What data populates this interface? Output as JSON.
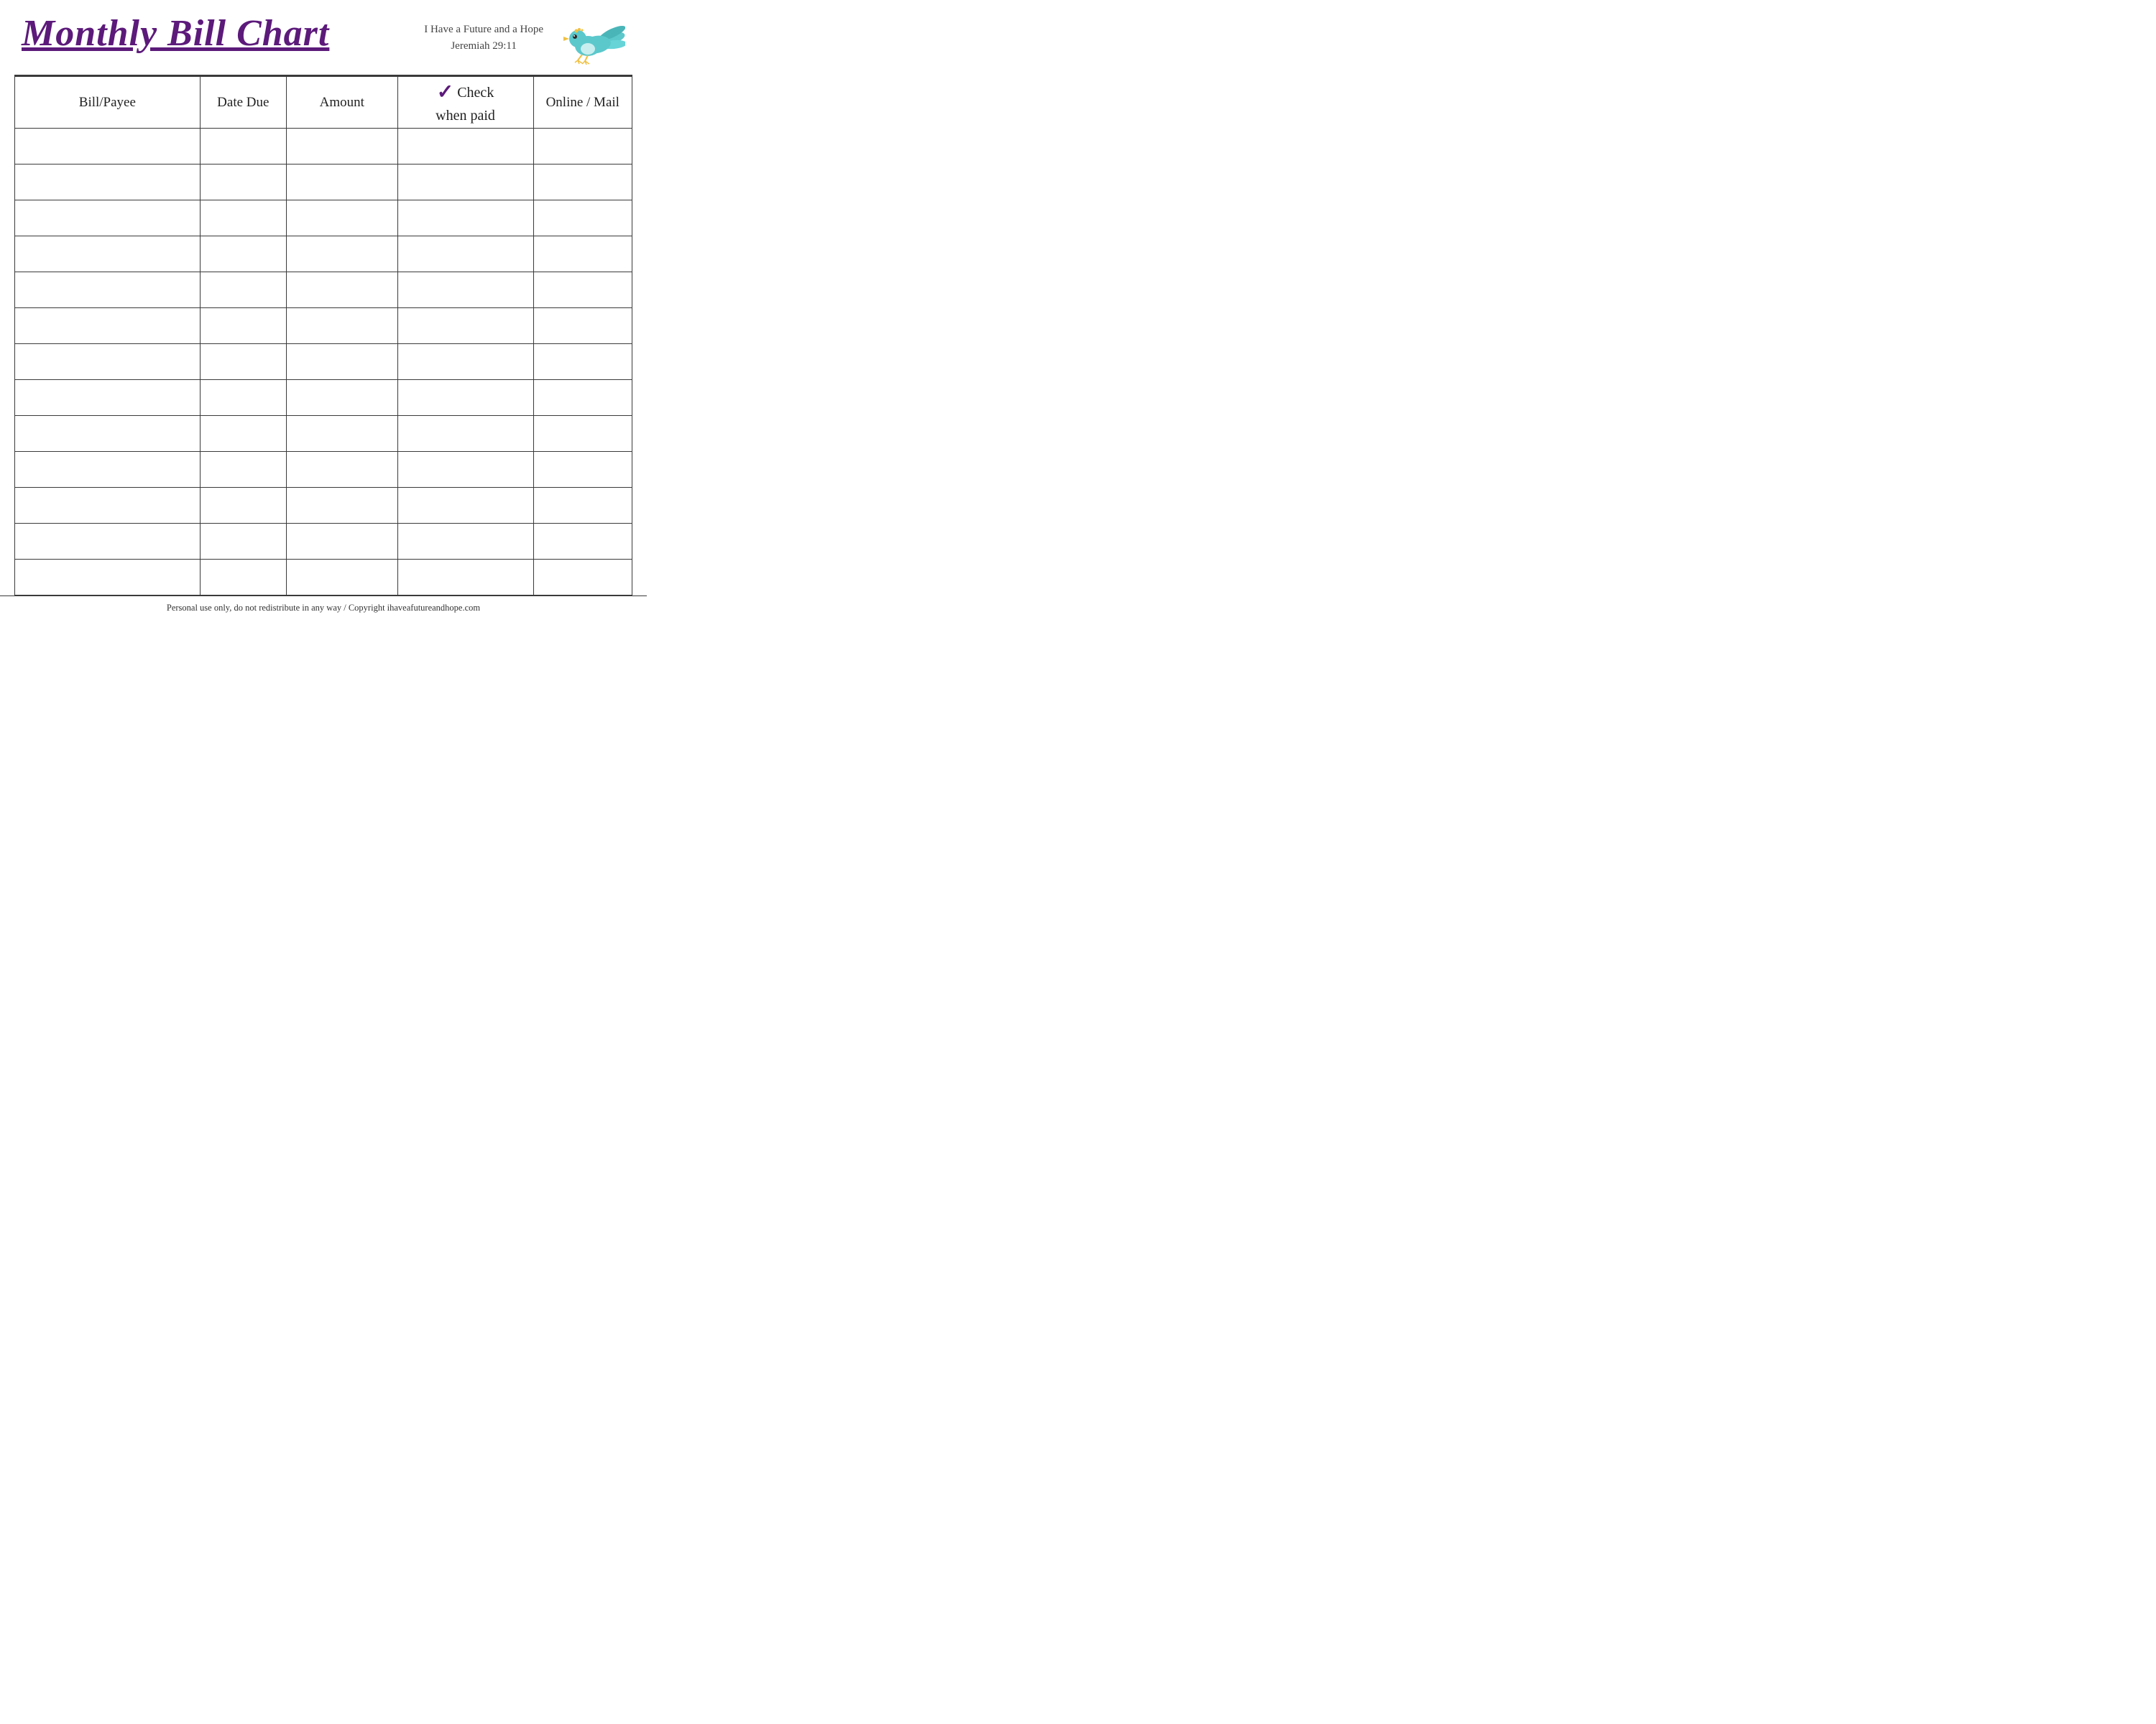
{
  "header": {
    "title": "Monthly Bill Chart",
    "tagline_line1": "I Have a Future and a Hope",
    "tagline_line2": "Jeremiah 29:11"
  },
  "table": {
    "columns": [
      {
        "key": "payee",
        "label": "Bill/Payee"
      },
      {
        "key": "date",
        "label": "Date Due"
      },
      {
        "key": "amount",
        "label": "Amount"
      },
      {
        "key": "check",
        "label_line1": "Check",
        "label_line2": "when paid",
        "has_checkmark": true
      },
      {
        "key": "online",
        "label": "Online / Mail"
      }
    ],
    "row_count": 13
  },
  "footer": {
    "text": "Personal use only, do not redistribute in any way / Copyright ihaveafutureandhope.com"
  },
  "colors": {
    "title": "#5c1a7a",
    "border": "#3a3a3a",
    "checkmark": "#5c1a7a",
    "text": "#2a2a2a",
    "footer_text": "#333333"
  },
  "icons": {
    "bird": "bird-icon"
  }
}
